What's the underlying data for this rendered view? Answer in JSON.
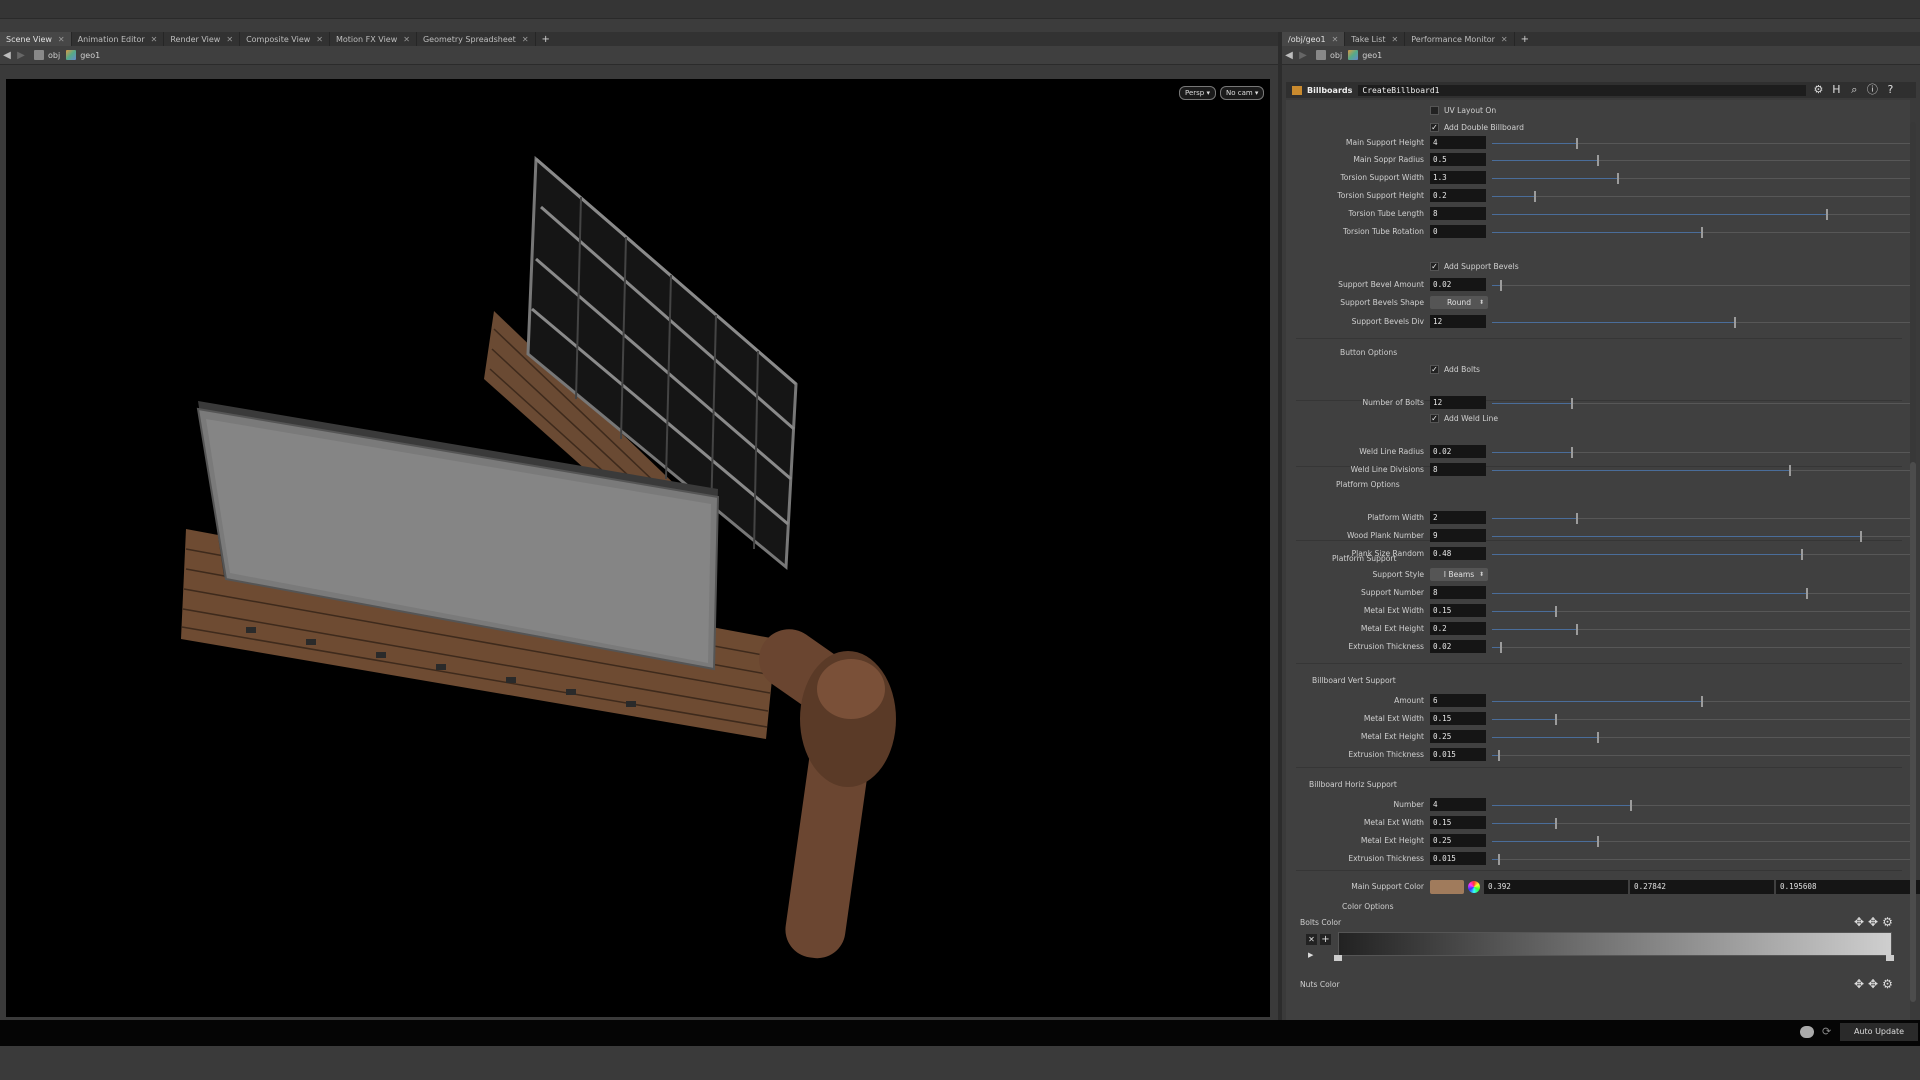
{
  "left_tabs": [
    {
      "label": "Scene View",
      "active": true
    },
    {
      "label": "Animation Editor"
    },
    {
      "label": "Render View"
    },
    {
      "label": "Composite View"
    },
    {
      "label": "Motion FX View"
    },
    {
      "label": "Geometry Spreadsheet"
    }
  ],
  "right_tabs": [
    {
      "label": "/obj/geo1",
      "active": true
    },
    {
      "label": "Take List"
    },
    {
      "label": "Performance Monitor"
    }
  ],
  "left_path": {
    "root": "obj",
    "node": "geo1"
  },
  "right_path": {
    "root": "obj",
    "node": "geo1"
  },
  "viewport": {
    "persp_label": "Persp ▾",
    "cam_label": "No cam ▾"
  },
  "node": {
    "type": "Billboards",
    "name": "CreateBillboard1"
  },
  "params": {
    "uv_layout": "UV Layout On",
    "add_double": "Add Double Billboard",
    "add_support_bevels": "Add Support Bevels",
    "add_bolts": "Add Bolts",
    "add_weld_line": "Add Weld Line",
    "sections": {
      "button_options": "Button Options",
      "platform_options": "Platform Options",
      "platform_support": "Platform Support",
      "billboard_vert": "Billboard Vert Support",
      "billboard_horiz": "Billboard Horiz Support",
      "color_options": "Color Options"
    },
    "rows": [
      {
        "label": "Main Support Height",
        "value": "4",
        "pos": 0.2
      },
      {
        "label": "Main Soppr Radius",
        "value": "0.5",
        "pos": 0.25
      },
      {
        "label": "Torsion Support Width",
        "value": "1.3",
        "pos": 0.3
      },
      {
        "label": "Torsion Support Height",
        "value": "0.2",
        "pos": 0.1
      },
      {
        "label": "Torsion Tube Length",
        "value": "8",
        "pos": 0.8
      },
      {
        "label": "Torsion Tube Rotation",
        "value": "0",
        "pos": 0.5
      },
      {
        "label": "Support Bevel Amount",
        "value": "0.02",
        "pos": 0.02
      },
      {
        "label": "Support Bevels Div",
        "value": "12",
        "pos": 0.58
      },
      {
        "label": "Number of Bolts",
        "value": "12",
        "pos": 0.19
      },
      {
        "label": "Weld Line Radius",
        "value": "0.02",
        "pos": 0.19
      },
      {
        "label": "Weld Line Divisions",
        "value": "8",
        "pos": 0.71
      },
      {
        "label": "Platform Width",
        "value": "2",
        "pos": 0.2
      },
      {
        "label": "Wood Plank Number",
        "value": "9",
        "pos": 0.88
      },
      {
        "label": "Plank Size Random",
        "value": "0.48",
        "pos": 0.74
      },
      {
        "label": "Support Number",
        "value": "8",
        "pos": 0.75
      },
      {
        "label": "Metal Ext  Width",
        "value": "0.15",
        "pos": 0.15
      },
      {
        "label": "Metal Ext Height",
        "value": "0.2",
        "pos": 0.2
      },
      {
        "label": "Extrusion Thickness",
        "value": "0.02",
        "pos": 0.02
      },
      {
        "label": "Amount",
        "value": "6",
        "pos": 0.5
      },
      {
        "label": "Metal Ext  Width",
        "value": "0.15",
        "pos": 0.15
      },
      {
        "label": "Metal Ext Height",
        "value": "0.25",
        "pos": 0.25
      },
      {
        "label": "Extrusion Thickness",
        "value": "0.015",
        "pos": 0.015
      },
      {
        "label": "Number",
        "value": "4",
        "pos": 0.33
      },
      {
        "label": "Metal Ext  Width",
        "value": "0.15",
        "pos": 0.15
      },
      {
        "label": "Metal Ext Height",
        "value": "0.25",
        "pos": 0.25
      },
      {
        "label": "Extrusion Thickness",
        "value": "0.015",
        "pos": 0.015
      }
    ],
    "bevel_shape_label": "Support Bevels Shape",
    "bevel_shape_value": "Round",
    "support_style_label": "Support Style",
    "support_style_value": "I Beams",
    "main_support_color_label": "Main Support Color",
    "main_support_color": {
      "r": "0.392",
      "g": "0.27842",
      "b": "0.195608",
      "swatch": "#a07b5c"
    },
    "bolts_color": "Bolts Color",
    "nuts_color": "Nuts Color"
  },
  "status": {
    "auto_update": "Auto Update"
  }
}
